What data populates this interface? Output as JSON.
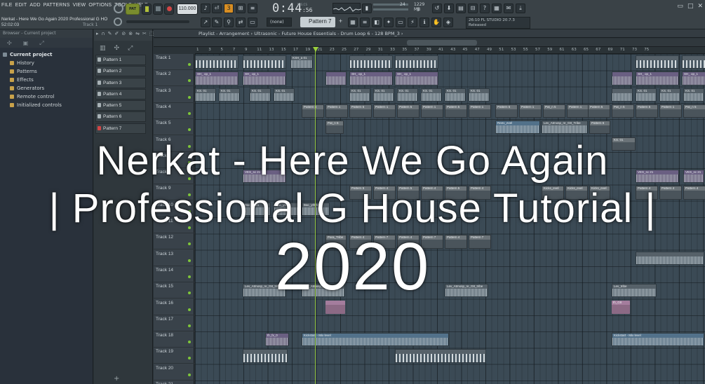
{
  "menu": [
    "FILE",
    "EDIT",
    "ADD",
    "PATTERNS",
    "VIEW",
    "OPTIONS",
    "TOOLS",
    "HELP"
  ],
  "song": {
    "title": "Nerkat - Here We Go Again 2020 Professional G HO",
    "position": "52:02:03",
    "track_hint": "Track 1"
  },
  "transport": {
    "pat_label": "PAT",
    "tempo": "110.000",
    "time_big": "0:44",
    "time_small": ":56",
    "mcs": "M:S:CS"
  },
  "cpu": {
    "value1": "24",
    "value2": "1229 MB",
    "value3": "3"
  },
  "toolbar": {
    "snap": "(none)",
    "pattern": "Pattern 7",
    "pattern_add": "+"
  },
  "news": {
    "line1": "26:10  FL STUDIO 20.7.3",
    "line2": "Released"
  },
  "browser": {
    "header": "Browser - Current project",
    "root": "Current project",
    "items": [
      "History",
      "Patterns",
      "Effects",
      "Generators",
      "Remote control",
      "Initialized controls"
    ]
  },
  "rack": {
    "patterns": [
      "Pattern 1",
      "Pattern 2",
      "Pattern 3",
      "Pattern 4",
      "Pattern 5",
      "Pattern 6",
      "Pattern 7"
    ]
  },
  "playlist": {
    "title": "Playlist - Arrangement › Ultrasonic - Future House Essentials - Drum Loop 6 - 128 BPM_3 ›",
    "ruler": [
      "1",
      "3",
      "5",
      "7",
      "9",
      "11",
      "13",
      "15",
      "17",
      "19",
      "21",
      "23",
      "25",
      "27",
      "29",
      "31",
      "33",
      "35",
      "37",
      "39",
      "41",
      "43",
      "45",
      "47",
      "49",
      "51",
      "53",
      "55",
      "57",
      "59",
      "61",
      "63",
      "65",
      "67",
      "69",
      "71",
      "73",
      "75"
    ],
    "tracks": [
      "Track 1",
      "Track 2",
      "Track 3",
      "Track 4",
      "Track 5",
      "Track 6",
      "Track 7",
      "Track 8",
      "Track 9",
      "Track 10",
      "Track 11",
      "Track 12",
      "Track 13",
      "Track 14",
      "Track 15",
      "Track 16",
      "Track 17",
      "Track 18",
      "Track 19",
      "Track 20",
      "Track 21"
    ],
    "clip_labels": {
      "ksh": "KSH_a 01",
      "sh_op": "SH_ op_1",
      "ks01": "KS. 01",
      "pattern5": "Pattern 5",
      "pattern1": "Pattern 1",
      "pattern4": "Pattern 4",
      "pattern6": "Pattern 6",
      "pattern7": "Pattern 7",
      "pat_n5": "Pat_n 5",
      "reev": "Reev_evel",
      "lev_g8": "Lev_Atmosp_re_G8_Tribe",
      "ves": "VES_sc 21",
      "kicks": "Kicks_evel",
      "bac": "Bac_ythm",
      "para": "Para_Tribe",
      "lev": "Lev_Atmosp_re_G8_tribe",
      "lev_short": "Lev_tribe",
      "kickstart": "Kickstart - Mix level",
      "th_fx": "th_fx_0",
      "th_g8": "th_G8"
    }
  },
  "overlay": {
    "line1": "Nerkat - Here We Go Again",
    "line2": "| Professional G House Tutorial |",
    "line3": "2020"
  }
}
